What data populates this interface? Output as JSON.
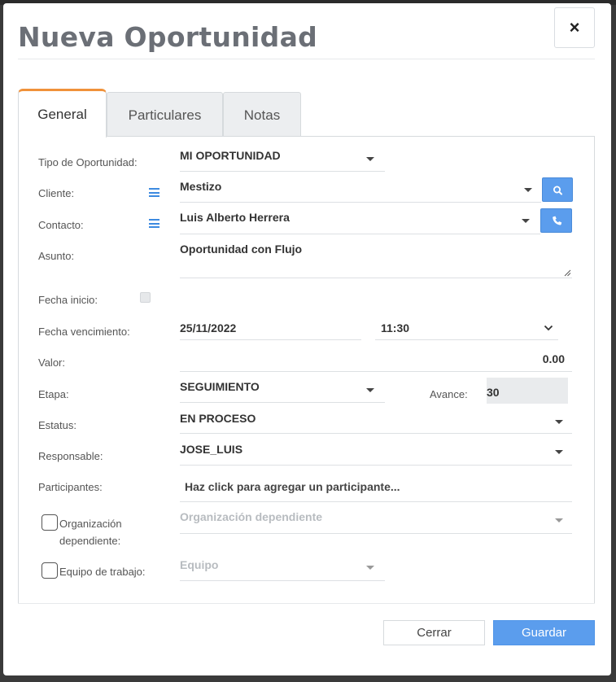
{
  "modal": {
    "title": "Nueva Oportunidad",
    "close_label": "×"
  },
  "tabs": [
    {
      "label": "General",
      "active": true
    },
    {
      "label": "Particulares",
      "active": false
    },
    {
      "label": "Notas",
      "active": false
    }
  ],
  "form": {
    "tipo": {
      "label": "Tipo de Oportunidad:",
      "value": "MI OPORTUNIDAD"
    },
    "cliente": {
      "label": "Cliente:",
      "value": "Mestizo",
      "list_icon": "list-icon",
      "button_icon": "search-icon"
    },
    "contacto": {
      "label": "Contacto:",
      "value": "Luis Alberto Herrera",
      "list_icon": "list-icon",
      "button_icon": "phone-icon"
    },
    "asunto": {
      "label": "Asunto:",
      "value": "Oportunidad con Flujo"
    },
    "fecha_inicio": {
      "label": "Fecha inicio:"
    },
    "fecha_vencimiento": {
      "label": "Fecha vencimiento:",
      "date": "25/11/2022",
      "time": "11:30"
    },
    "valor": {
      "label": "Valor:",
      "value": "0.00"
    },
    "etapa": {
      "label": "Etapa:",
      "value": "SEGUIMIENTO"
    },
    "avance": {
      "label": "Avance:",
      "value": "30"
    },
    "estatus": {
      "label": "Estatus:",
      "value": "EN PROCESO"
    },
    "responsable": {
      "label": "Responsable:",
      "value": "JOSE_LUIS"
    },
    "participantes": {
      "label": "Participantes:",
      "placeholder": "Haz click para agregar un participante..."
    },
    "organizacion": {
      "label_line1": "Organización",
      "label_line2": "dependiente:",
      "placeholder": "Organización dependiente"
    },
    "equipo": {
      "label": "Equipo de trabajo:",
      "placeholder": "Equipo"
    }
  },
  "footer": {
    "cancel_label": "Cerrar",
    "save_label": "Guardar"
  },
  "colors": {
    "accent": "#5b9ded",
    "tab_active_border": "#f0923a",
    "title": "#6b6f76"
  }
}
